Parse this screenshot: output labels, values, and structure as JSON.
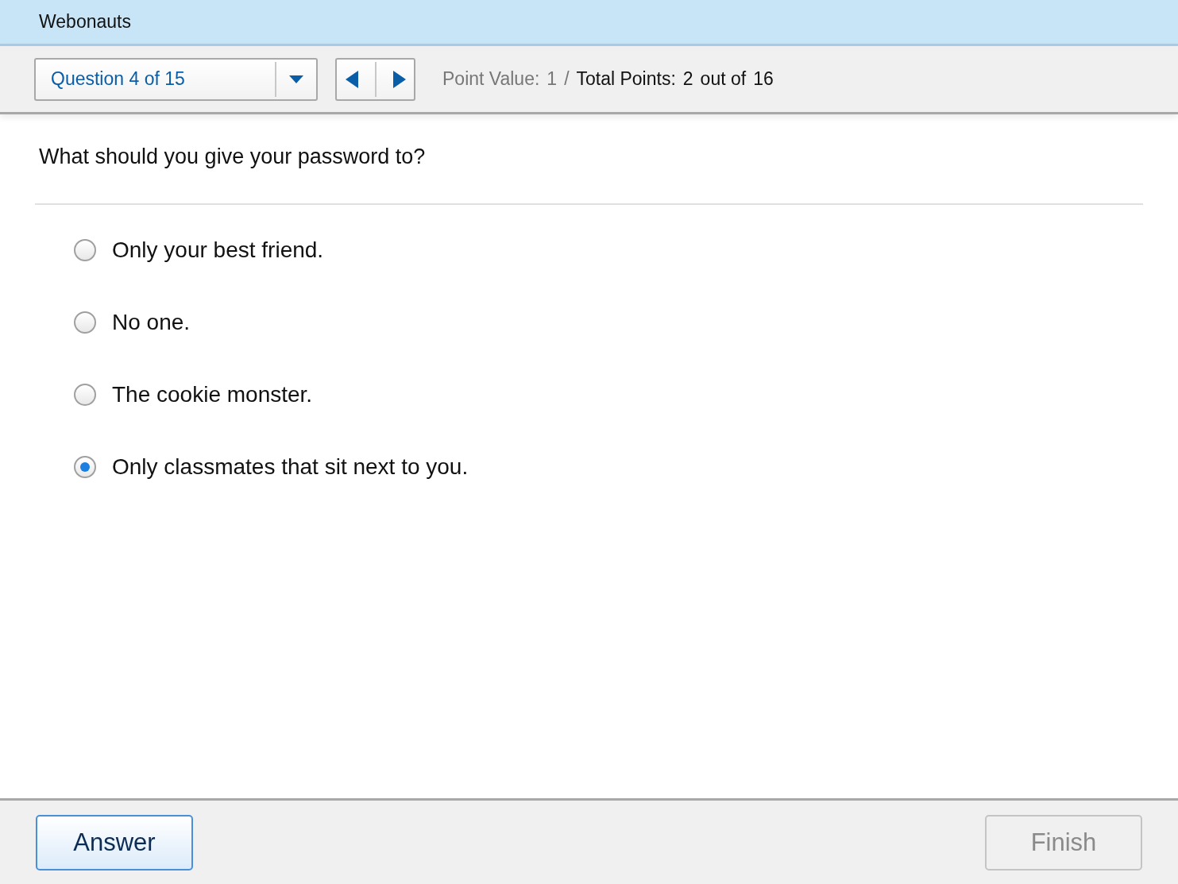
{
  "header": {
    "title": "Webonauts"
  },
  "toolbar": {
    "question_select": {
      "value": "Question 4 of 15"
    },
    "points": [
      {
        "text": "Point Value:",
        "muted": true
      },
      {
        "text": "1",
        "muted": true
      },
      {
        "text": "/",
        "muted": true
      },
      {
        "text": "Total Points:",
        "muted": false
      },
      {
        "text": "2",
        "muted": false
      },
      {
        "text": "out of",
        "muted": false
      },
      {
        "text": "16",
        "muted": false
      }
    ]
  },
  "question": {
    "text": "What should you give your password to?"
  },
  "options": [
    {
      "label": "Only your best friend.",
      "selected": false
    },
    {
      "label": "No one.",
      "selected": false
    },
    {
      "label": "The cookie monster.",
      "selected": false
    },
    {
      "label": "Only classmates that sit next to you.",
      "selected": true
    }
  ],
  "buttons": [
    {
      "label": "Answer",
      "disabled": false
    },
    {
      "label": "Finish",
      "disabled": true
    }
  ]
}
